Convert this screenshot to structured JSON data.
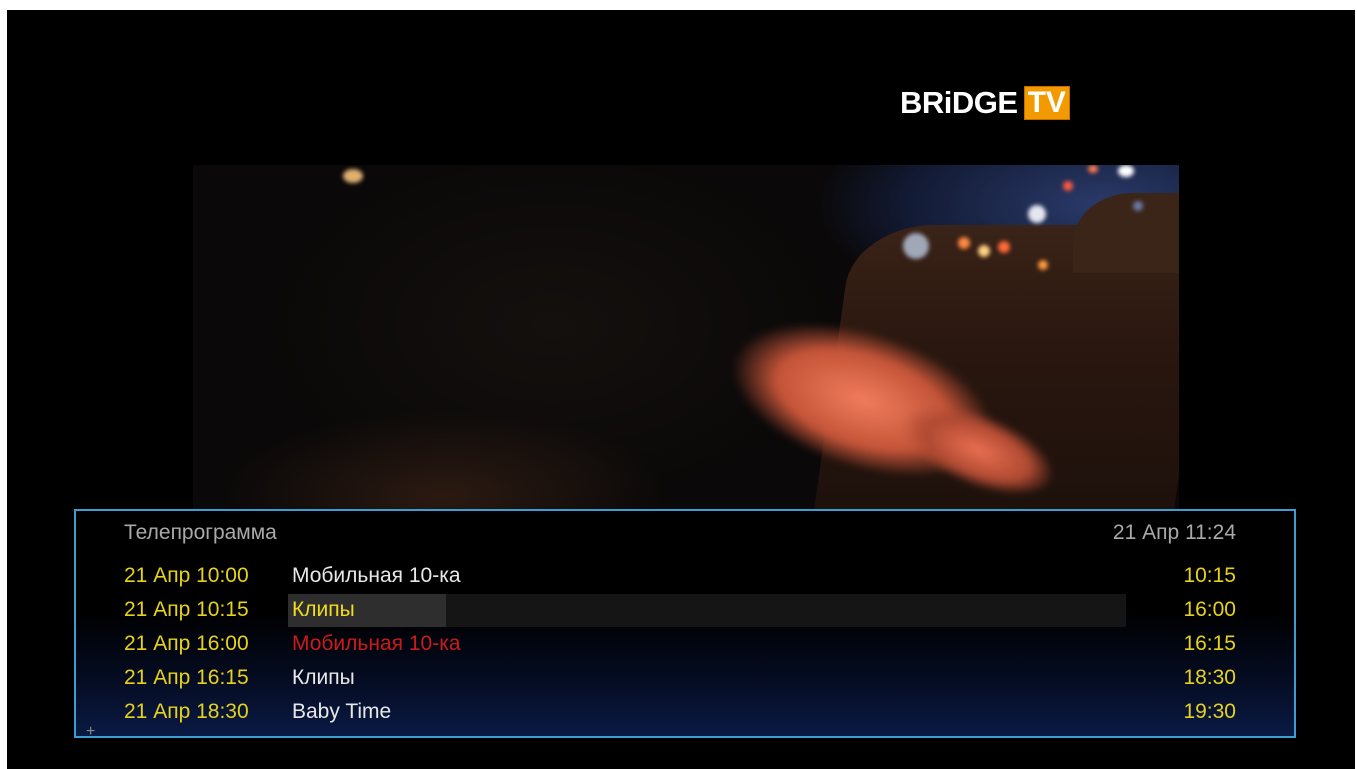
{
  "channel": {
    "logo_text": "BRiDGE",
    "logo_tv": "TV",
    "logo_tv_color": "#f39a00"
  },
  "epg": {
    "title": "Телепрограмма",
    "now": "21 Апр 11:24",
    "frame_color": "#3a9ed4",
    "time_color": "#e6d21d",
    "current_color": "#cc1a1a",
    "rows": [
      {
        "start": "21 Апр 10:00",
        "name": "Мобильная 10-ка",
        "end": "10:15"
      },
      {
        "start": "21 Апр 10:15",
        "name": "Клипы",
        "end": "16:00"
      },
      {
        "start": "21 Апр 16:00",
        "name": "Мобильная 10-ка",
        "end": "16:15"
      },
      {
        "start": "21 Апр 16:15",
        "name": "Клипы",
        "end": "18:30"
      },
      {
        "start": "21 Апр 18:30",
        "name": "Baby Time",
        "end": "19:30"
      }
    ],
    "more_indicator": "+"
  }
}
